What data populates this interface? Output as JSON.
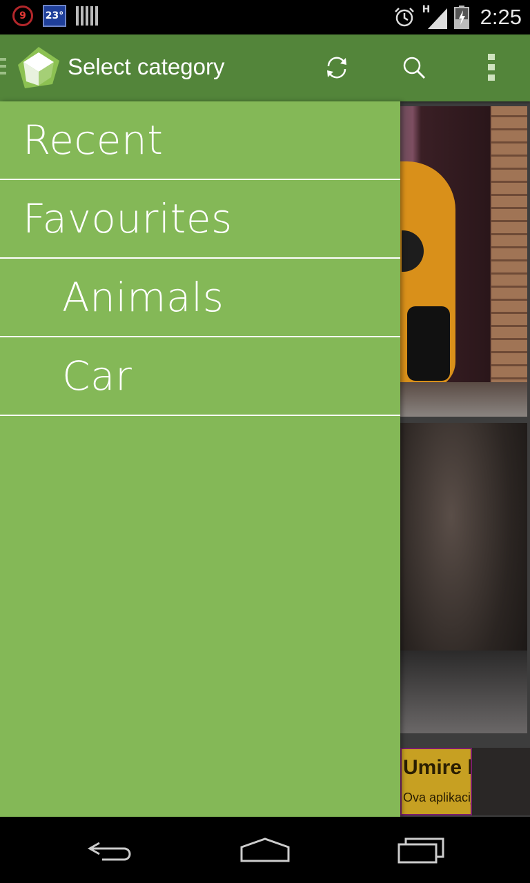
{
  "status_bar": {
    "notification_count": "9",
    "temperature": "23°",
    "time": "2:25",
    "network_type": "H",
    "icons": [
      "circle-count-icon",
      "weather-icon",
      "barcode-icon",
      "alarm-icon",
      "signal-icon",
      "battery-charging-icon"
    ]
  },
  "action_bar": {
    "title": "Select category",
    "icons": [
      "menu-icon",
      "app-logo-icon",
      "refresh-icon",
      "search-icon",
      "overflow-menu-icon"
    ],
    "color": "#53853a"
  },
  "drawer": {
    "color": "#84b857",
    "items": [
      {
        "label": "Recent",
        "level": 0
      },
      {
        "label": "Favourites",
        "level": 0
      },
      {
        "label": "Animals",
        "level": 1
      },
      {
        "label": "Car",
        "level": 1
      }
    ]
  },
  "ad": {
    "title": "Umire baterija brzo?",
    "subtitle": "Ova aplikacija to može popraviti"
  },
  "nav_bar": {
    "icons": [
      "back-icon",
      "home-icon",
      "recent-apps-icon"
    ]
  }
}
